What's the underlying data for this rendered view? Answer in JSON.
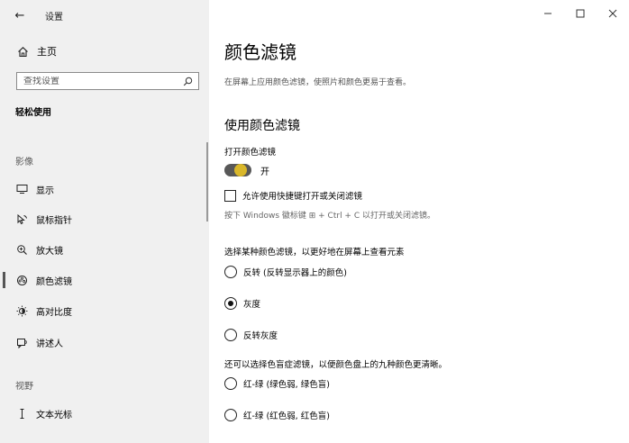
{
  "window": {
    "title": "设置",
    "controls": {
      "minimize": "—",
      "maximize": "☐",
      "close": "✕"
    }
  },
  "sidebar": {
    "home_label": "主页",
    "search_placeholder": "查找设置",
    "section_title": "轻松使用",
    "groups": [
      {
        "label": "影像"
      },
      {
        "label": "视野"
      }
    ],
    "items": [
      {
        "label": "显示",
        "icon": "monitor-icon"
      },
      {
        "label": "鼠标指针",
        "icon": "mouse-pointer-icon"
      },
      {
        "label": "放大镜",
        "icon": "magnifier-icon"
      },
      {
        "label": "颜色滤镜",
        "icon": "color-filter-icon",
        "active": true
      },
      {
        "label": "高对比度",
        "icon": "contrast-icon"
      },
      {
        "label": "讲述人",
        "icon": "narrator-icon"
      },
      {
        "label": "文本光标",
        "icon": "text-cursor-icon"
      }
    ]
  },
  "main": {
    "title": "颜色滤镜",
    "description": "在屏幕上应用颜色滤镜，使照片和颜色更易于查看。",
    "subheading": "使用颜色滤镜",
    "toggle_caption": "打开颜色滤镜",
    "toggle_state": "开",
    "toggle_on": true,
    "shortcut_checkbox_label": "允许使用快捷键打开或关闭滤镜",
    "shortcut_checked": false,
    "shortcut_hint": "按下 Windows 徽标键 ⊞ + Ctrl + C 以打开或关闭滤镜。",
    "filter_caption": "选择某种颜色滤镜，以更好地在屏幕上查看元素",
    "filters": [
      {
        "label": "反转 (反转显示器上的颜色)",
        "selected": false
      },
      {
        "label": "灰度",
        "selected": true
      },
      {
        "label": "反转灰度",
        "selected": false
      }
    ],
    "colorblind_caption": "还可以选择色盲症滤镜，以便颜色盘上的九种颜色更清晰。",
    "colorblind_filters": [
      {
        "label": "红-绿 (绿色弱, 绿色盲)",
        "selected": false
      },
      {
        "label": "红-绿 (红色弱, 红色盲)",
        "selected": false
      }
    ]
  },
  "colors": {
    "sidebar_bg": "#f0f0f0",
    "toggle_track": "#585858",
    "toggle_knob": "#d9b72a"
  }
}
